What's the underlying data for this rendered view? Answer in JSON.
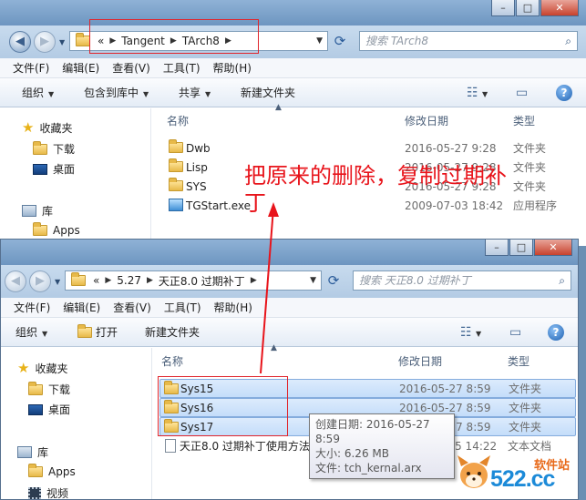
{
  "top_window": {
    "address": {
      "back": "«",
      "segments": [
        "Tangent",
        "TArch8"
      ]
    },
    "search_placeholder": "搜索 TArch8",
    "menu": [
      "文件(F)",
      "编辑(E)",
      "查看(V)",
      "工具(T)",
      "帮助(H)"
    ],
    "toolbar": {
      "organize": "组织",
      "include": "包含到库中",
      "share": "共享",
      "new_folder": "新建文件夹"
    },
    "nav": {
      "favorites": "收藏夹",
      "downloads": "下载",
      "desktop": "桌面",
      "libraries": "库",
      "apps": "Apps"
    },
    "columns": {
      "name": "名称",
      "date": "修改日期",
      "type": "类型"
    },
    "files": [
      {
        "name": "Dwb",
        "date": "2016-05-27 9:28",
        "type": "文件夹"
      },
      {
        "name": "Lisp",
        "date": "2016-05-27 9:28",
        "type": "文件夹"
      },
      {
        "name": "SYS",
        "date": "2016-05-27 9:28",
        "type": "文件夹"
      },
      {
        "name": "TGStart.exe",
        "date": "2009-07-03 18:42",
        "type": "应用程序"
      }
    ]
  },
  "bottom_window": {
    "address": {
      "back": "«",
      "segments": [
        "5.27",
        "天正8.0 过期补丁"
      ]
    },
    "search_placeholder": "搜索 天正8.0 过期补丁",
    "menu": [
      "文件(F)",
      "编辑(E)",
      "查看(V)",
      "工具(T)",
      "帮助(H)"
    ],
    "toolbar": {
      "organize": "组织",
      "open": "打开",
      "new_folder": "新建文件夹"
    },
    "nav": {
      "favorites": "收藏夹",
      "downloads": "下载",
      "desktop": "桌面",
      "libraries": "库",
      "apps": "Apps",
      "videos": "视频"
    },
    "columns": {
      "name": "名称",
      "date": "修改日期",
      "type": "类型"
    },
    "files": [
      {
        "name": "Sys15",
        "date": "2016-05-27 8:59",
        "type": "文件夹"
      },
      {
        "name": "Sys16",
        "date": "2016-05-27 8:59",
        "type": "文件夹"
      },
      {
        "name": "Sys17",
        "date": "2016-05-27 8:59",
        "type": "文件夹"
      },
      {
        "name": "天正8.0 过期补丁使用方法",
        "date": "2011-02-15 14:22",
        "type": "文本文档"
      }
    ],
    "tooltip": {
      "created": "创建日期: 2016-05-27 8:59",
      "size": "大小: 6.26 MB",
      "files": "文件: tch_kernal.arx"
    }
  },
  "annotation": {
    "line1": "把原来的删除，复制过期补",
    "line2": "丁"
  },
  "watermark": {
    "text": "软件站",
    "domain": "522.cc"
  },
  "colors": {
    "annotation": "#e8141b",
    "selection": "#c4ddfa",
    "titlebar": "#7a9fc8"
  }
}
